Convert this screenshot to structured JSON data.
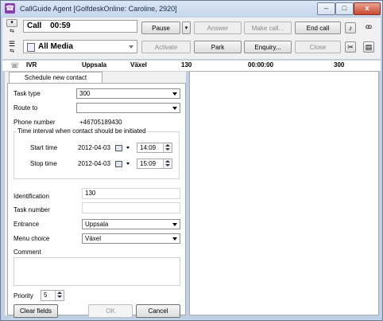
{
  "window": {
    "title": "CallGuide Agent [GolfdeskOnline: Caroline, 2920]",
    "minimize_label": "–",
    "maximize_label": "□",
    "close_label": "x"
  },
  "toolbar": {
    "call_label": "Call",
    "call_timer": "00:59",
    "media_value": "All Media",
    "pause_label": "Pause",
    "answer_label": "Answer",
    "make_call_label": "Make call...",
    "end_call_label": "End call",
    "activate_label": "Activate",
    "park_label": "Park",
    "enquiry_label": "Enquiry...",
    "close_label": "Close"
  },
  "status_row": {
    "queue": "IVR",
    "location": "Uppsala",
    "switchboard": "Växel",
    "number": "130",
    "duration": "00:00:00",
    "count": "300"
  },
  "tab": {
    "label": "Schedule new contact"
  },
  "form": {
    "task_type_label": "Task type",
    "task_type_value": "300",
    "route_to_label": "Route to",
    "route_to_value": "",
    "phone_label": "Phone number",
    "phone_value": "+46705189430",
    "interval_legend": "Time interval when contact should be initiated",
    "start_label": "Start time",
    "start_date": "2012-04-03",
    "start_time": "14:09",
    "stop_label": "Stop time",
    "stop_date": "2012-04-03",
    "stop_time": "15:09",
    "identification_label": "Identification",
    "identification_value": "130",
    "task_number_label": "Task number",
    "task_number_value": "",
    "entrance_label": "Entrance",
    "entrance_value": "Uppsala",
    "menu_choice_label": "Menu choice",
    "menu_choice_value": "Växel",
    "comment_label": "Comment",
    "priority_label": "Priority",
    "priority_value": "5",
    "clear_label": "Clear fields",
    "ok_label": "OK",
    "cancel_label": "Cancel"
  },
  "colors": {
    "title_bar": "#c5d6ec",
    "window_frame": "#bfcfe4",
    "close_button": "#c8482f",
    "app_icon": "#8a3fb0"
  }
}
